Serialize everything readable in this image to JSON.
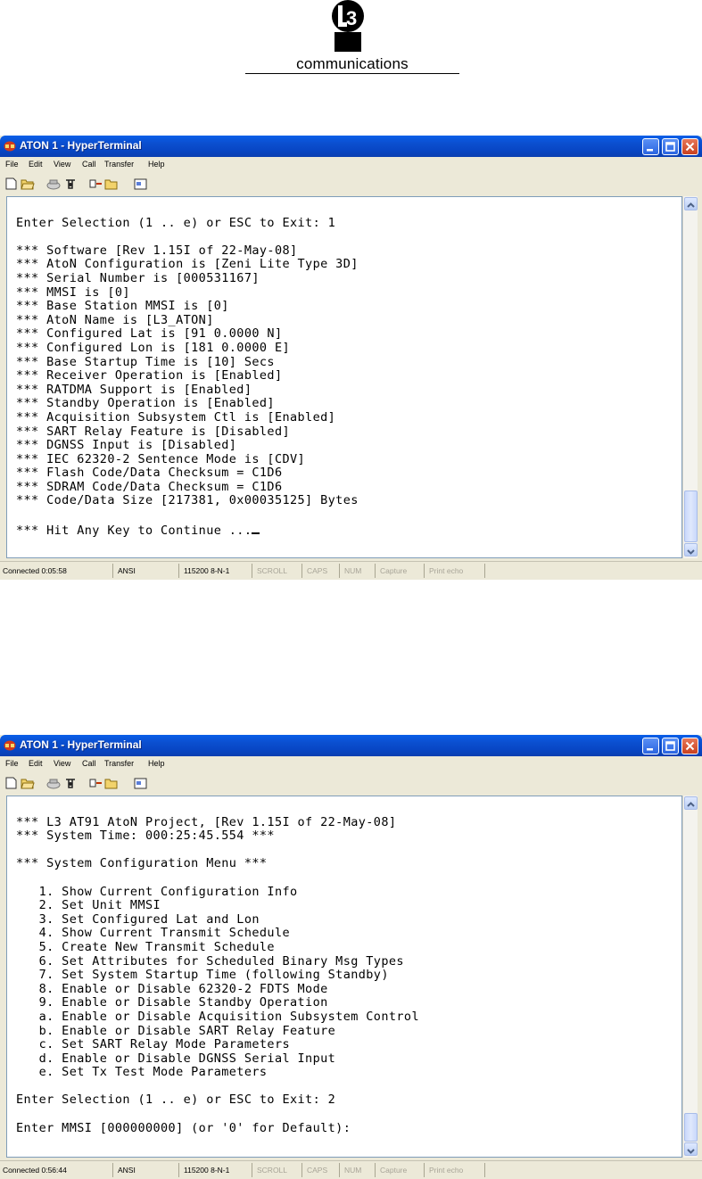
{
  "logo": {
    "mark_text": "L3",
    "wordmark": "communications"
  },
  "window1": {
    "title": "ATON 1 - HyperTerminal",
    "menu": [
      "File",
      "Edit",
      "View",
      "Call",
      "Transfer",
      "Help"
    ],
    "terminal_text": "\nEnter Selection (1 .. e) or ESC to Exit: 1\n\n*** Software [Rev 1.15I of 22-May-08]\n*** AtoN Configuration is [Zeni Lite Type 3D]\n*** Serial Number is [000531167]\n*** MMSI is [0]\n*** Base Station MMSI is [0]\n*** AtoN Name is [L3_ATON]\n*** Configured Lat is [91 0.0000 N]\n*** Configured Lon is [181 0.0000 E]\n*** Base Startup Time is [10] Secs\n*** Receiver Operation is [Enabled]\n*** RATDMA Support is [Enabled]\n*** Standby Operation is [Enabled]\n*** Acquisition Subsystem Ctl is [Enabled]\n*** SART Relay Feature is [Disabled]\n*** DGNSS Input is [Disabled]\n*** IEC 62320-2 Sentence Mode is [CDV]\n*** Flash Code/Data Checksum = C1D6\n*** SDRAM Code/Data Checksum = C1D6\n*** Code/Data Size [217381, 0x00035125] Bytes\n\n*** Hit Any Key to Continue ...",
    "status": {
      "connected": "Connected 0:05:58",
      "emulation": "ANSI",
      "settings": "115200 8-N-1",
      "scroll": "SCROLL",
      "caps": "CAPS",
      "num": "NUM",
      "capture": "Capture",
      "print_echo": "Print echo"
    },
    "scroll_position": 0.95
  },
  "window2": {
    "title": "ATON 1 - HyperTerminal",
    "menu": [
      "File",
      "Edit",
      "View",
      "Call",
      "Transfer",
      "Help"
    ],
    "terminal_text": "\n*** L3 AT91 AtoN Project, [Rev 1.15I of 22-May-08]\n*** System Time: 000:25:45.554 ***\n\n*** System Configuration Menu ***\n\n   1. Show Current Configuration Info\n   2. Set Unit MMSI\n   3. Set Configured Lat and Lon\n   4. Show Current Transmit Schedule\n   5. Create New Transmit Schedule\n   6. Set Attributes for Scheduled Binary Msg Types\n   7. Set System Startup Time (following Standby)\n   8. Enable or Disable 62320-2 FDTS Mode\n   9. Enable or Disable Standby Operation\n   a. Enable or Disable Acquisition Subsystem Control\n   b. Enable or Disable SART Relay Feature\n   c. Set SART Relay Mode Parameters\n   d. Enable or Disable DGNSS Serial Input\n   e. Set Tx Test Mode Parameters\n\nEnter Selection (1 .. e) or ESC to Exit: 2\n\nEnter MMSI [000000000] (or '0' for Default):",
    "status": {
      "connected": "Connected 0:56:44",
      "emulation": "ANSI",
      "settings": "115200 8-N-1",
      "scroll": "SCROLL",
      "caps": "CAPS",
      "num": "NUM",
      "capture": "Capture",
      "print_echo": "Print echo"
    },
    "scroll_position": 0.97
  }
}
